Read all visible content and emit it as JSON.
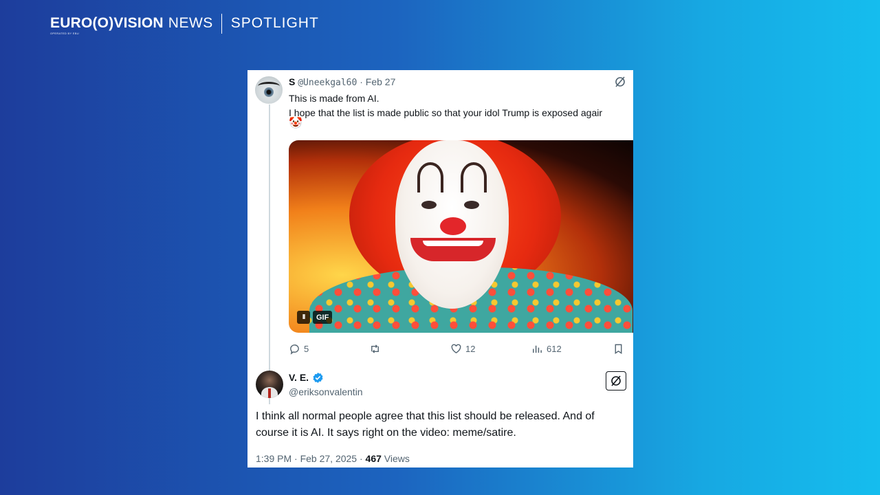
{
  "brand": {
    "logo_main": "EURO(O)VISION",
    "logo_news": "NEWS",
    "logo_sub": "OPERATED BY EBU",
    "section": "SPOTLIGHT"
  },
  "tweet1": {
    "name": "S",
    "handle": "@Uneekgal60",
    "separator": " · ",
    "date": "Feb 27",
    "line1": "This is made from AI.",
    "line2": "I hope that the list is made public so that your idol Trump is exposed agair",
    "emoji": "🤡",
    "media": {
      "pause_label": "II",
      "gif_label": "GIF"
    },
    "actions": {
      "replies": "5",
      "retweets": "",
      "likes": "12",
      "views": "612"
    }
  },
  "tweet2": {
    "name": "V. E.",
    "handle": "@eriksonvalentin",
    "text": "I think all normal people agree that this list should be released. And of course it is AI. It says right on the video: meme/satire.",
    "time": "1:39 PM · Feb 27, 2025 · ",
    "views_count": "467",
    "views_label": " Views"
  },
  "colors": {
    "bg_left": "#1d3d9c",
    "bg_right": "#15bdee",
    "text_primary": "#0f1419",
    "text_secondary": "#536471",
    "verified": "#1d9bf0"
  }
}
